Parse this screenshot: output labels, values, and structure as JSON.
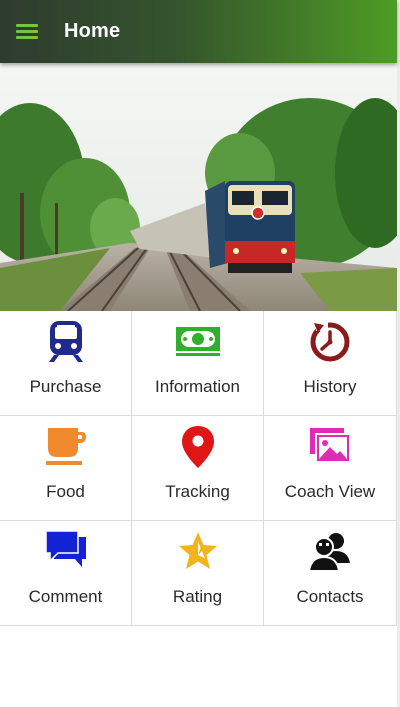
{
  "header": {
    "title": "Home",
    "menu_icon": "hamburger-menu-icon"
  },
  "theme": {
    "appbar_start": "#2e3b2f",
    "appbar_end": "#4e9c25",
    "menu_icon_color": "#7cc242"
  },
  "banner": {
    "image": "train-on-railway-photo"
  },
  "menu": [
    {
      "label": "Purchase",
      "icon": "train-icon",
      "color": "#1f2a8a"
    },
    {
      "label": "Information",
      "icon": "money-icon",
      "color": "#2fb02a"
    },
    {
      "label": "History",
      "icon": "history-clock-icon",
      "color": "#8b1a1a"
    },
    {
      "label": "Food",
      "icon": "coffee-cup-icon",
      "color": "#f08a2c"
    },
    {
      "label": "Tracking",
      "icon": "location-pin-icon",
      "color": "#e01616"
    },
    {
      "label": "Coach View",
      "icon": "photos-icon",
      "color": "#e02bb4"
    },
    {
      "label": "Comment",
      "icon": "chat-bubbles-icon",
      "color": "#1422d6"
    },
    {
      "label": "Rating",
      "icon": "star-icon",
      "color": "#f1b51b"
    },
    {
      "label": "Contacts",
      "icon": "contacts-people-icon",
      "color": "#111111"
    }
  ]
}
